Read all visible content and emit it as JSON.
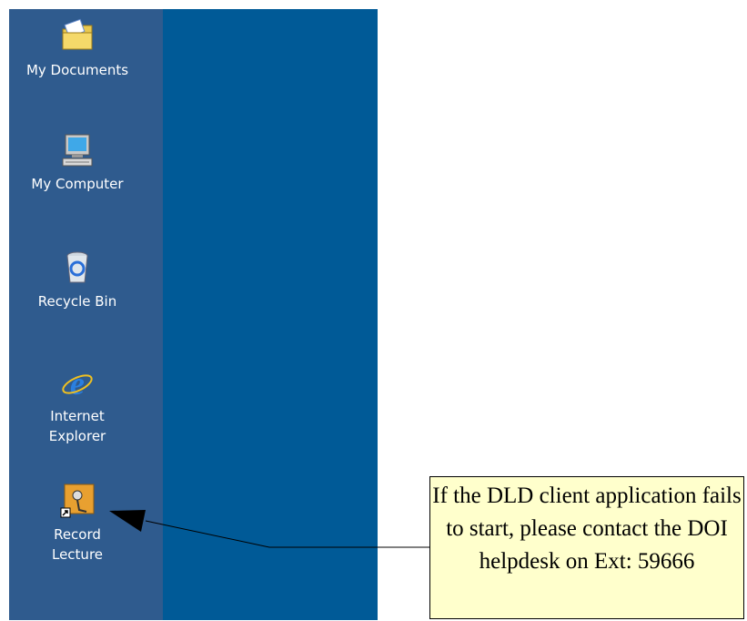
{
  "desktop": {
    "background_color": "#005a97",
    "icon_column_color": "#2f5b8e",
    "icons": [
      {
        "name": "folder-icon",
        "label": "My Documents"
      },
      {
        "name": "computer-icon",
        "label": "My Computer"
      },
      {
        "name": "recycle-bin-icon",
        "label": "Recycle Bin"
      },
      {
        "name": "internet-explorer-icon",
        "label": "Internet\nExplorer"
      },
      {
        "name": "record-lecture-icon",
        "label": "Record\nLecture"
      }
    ]
  },
  "callout": {
    "text": "If the DLD client application fails to start, please contact the DOI helpdesk on Ext: 59666",
    "background_color": "#ffffcc"
  }
}
